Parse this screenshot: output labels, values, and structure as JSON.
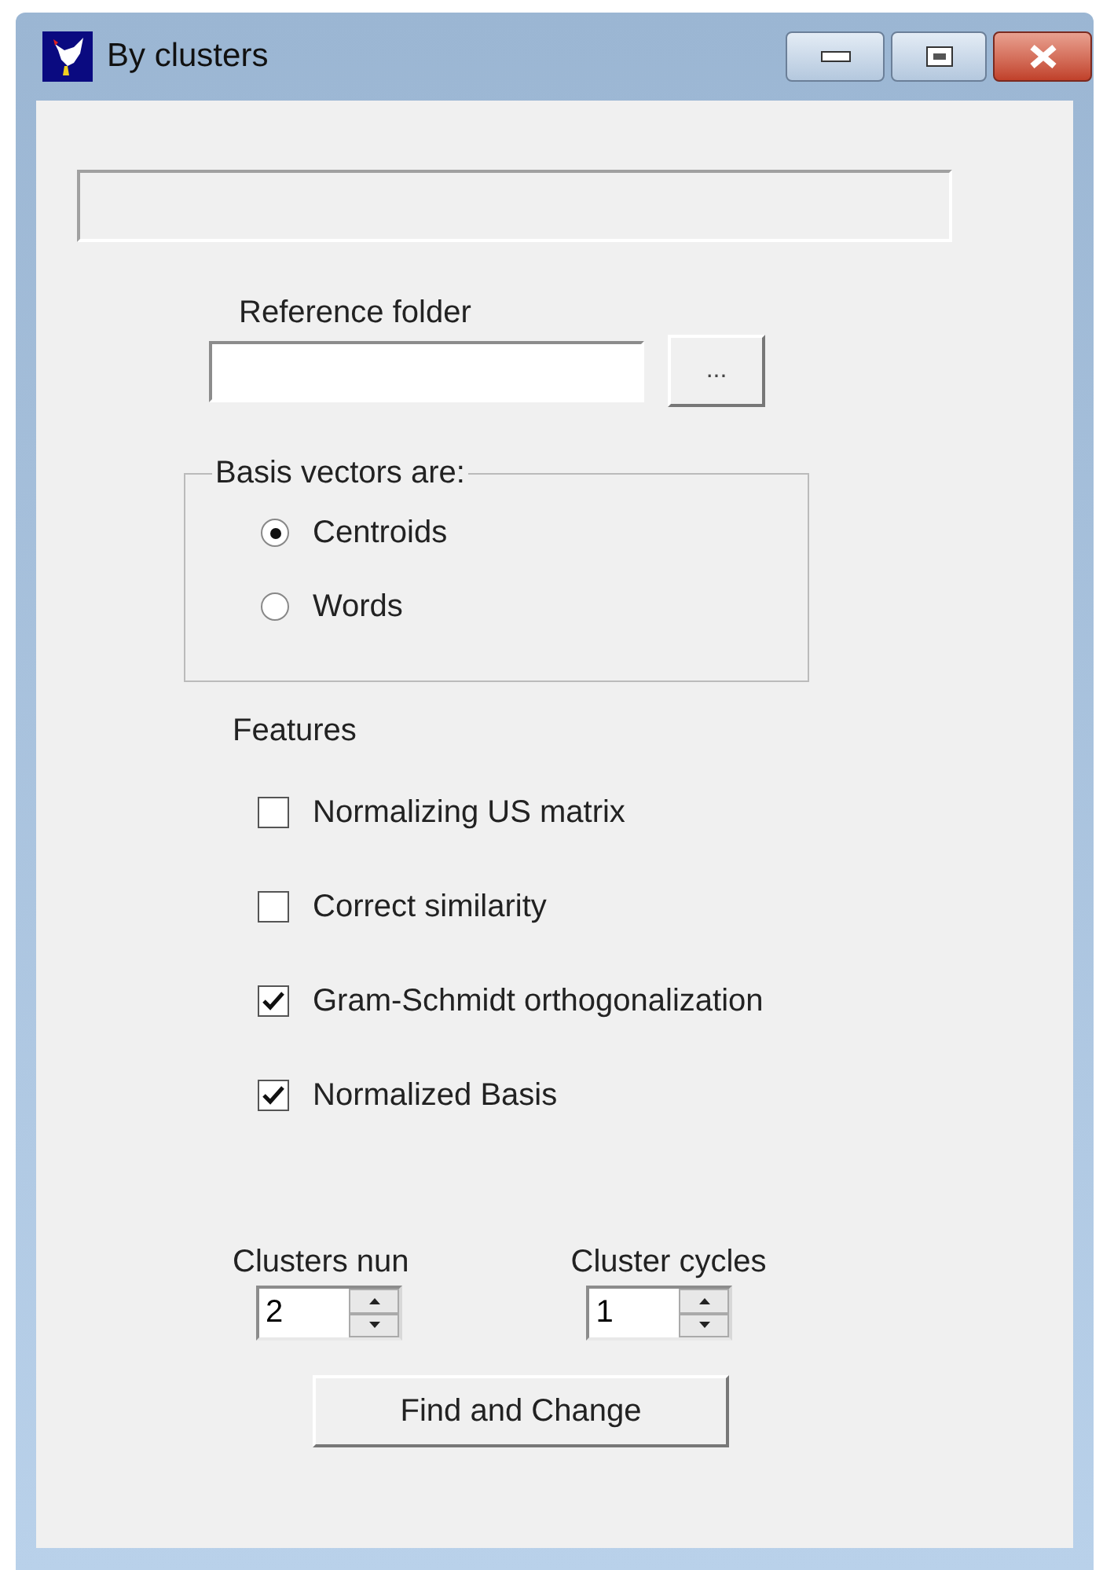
{
  "window": {
    "title": "By clusters"
  },
  "reference_folder": {
    "label": "Reference folder",
    "browse_button": "..."
  },
  "basis_group": {
    "legend": "Basis vectors are:",
    "options": [
      {
        "label": "Centroids",
        "selected": true
      },
      {
        "label": "Words",
        "selected": false
      }
    ]
  },
  "features": {
    "heading": "Features",
    "items": [
      {
        "label": "Normalizing US matrix",
        "checked": false
      },
      {
        "label": "Correct similarity",
        "checked": false
      },
      {
        "label": "Gram-Schmidt orthogonalization",
        "checked": true
      },
      {
        "label": "Normalized Basis",
        "checked": true
      }
    ]
  },
  "spinners": [
    {
      "label": "Clusters nun",
      "value": "2"
    },
    {
      "label": "Cluster cycles",
      "value": "1"
    }
  ],
  "action_button": "Find and Change"
}
